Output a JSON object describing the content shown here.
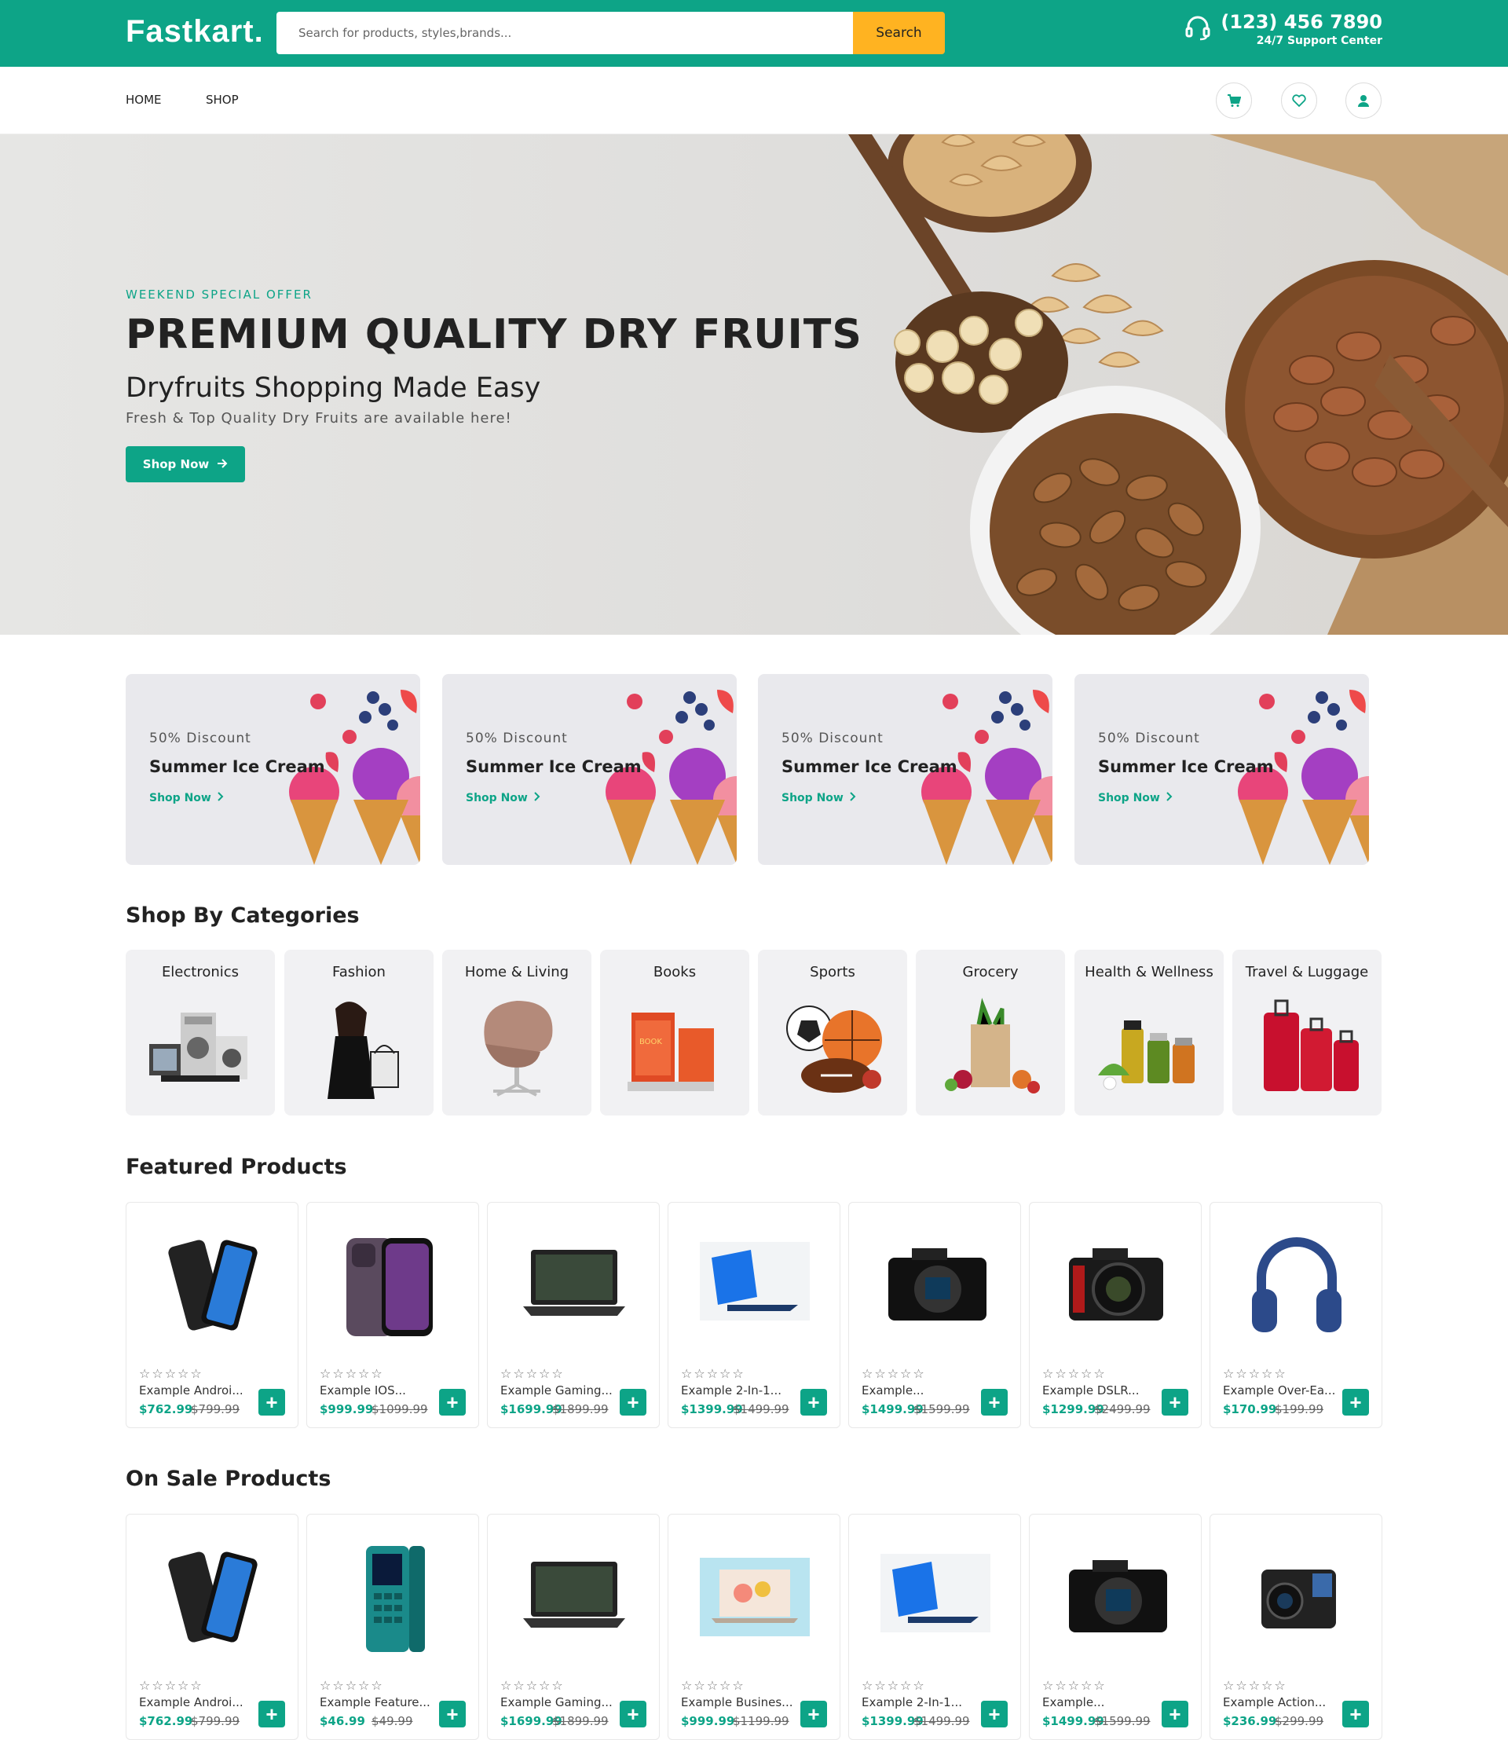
{
  "header": {
    "logo": "Fastkart.",
    "search_placeholder": "Search for products, styles,brands...",
    "search_button": "Search",
    "support_phone": "(123) 456 7890",
    "support_text": "24/7 Support Center"
  },
  "nav": {
    "home": "HOME",
    "shop": "SHOP"
  },
  "hero": {
    "kicker": "WEEKEND SPECIAL OFFER",
    "title": "PREMIUM QUALITY DRY FRUITS",
    "subtitle": "Dryfruits Shopping Made Easy",
    "description": "Fresh & Top Quality Dry Fruits are available here!",
    "button": "Shop Now"
  },
  "promos": [
    {
      "discount": "50% Discount",
      "title": "Summer Ice Cream",
      "link": "Shop Now"
    },
    {
      "discount": "50% Discount",
      "title": "Summer Ice Cream",
      "link": "Shop Now"
    },
    {
      "discount": "50% Discount",
      "title": "Summer Ice Cream",
      "link": "Shop Now"
    },
    {
      "discount": "50% Discount",
      "title": "Summer Ice Cream",
      "link": "Shop Now"
    }
  ],
  "categories_title": "Shop By Categories",
  "categories": [
    {
      "label": "Electronics",
      "icon": "electronics-icon"
    },
    {
      "label": "Fashion",
      "icon": "fashion-icon"
    },
    {
      "label": "Home & Living",
      "icon": "chair-icon"
    },
    {
      "label": "Books",
      "icon": "books-icon"
    },
    {
      "label": "Sports",
      "icon": "sports-balls-icon"
    },
    {
      "label": "Grocery",
      "icon": "grocery-bag-icon"
    },
    {
      "label": "Health & Wellness",
      "icon": "supplements-icon"
    },
    {
      "label": "Travel & Luggage",
      "icon": "luggage-icon"
    }
  ],
  "featured_title": "Featured Products",
  "featured": [
    {
      "name": "Example Androi...",
      "price": "$762.99",
      "old": "$799.99",
      "icon": "phone-icon"
    },
    {
      "name": "Example IOS...",
      "price": "$999.99",
      "old": "$1099.99",
      "icon": "iphone-icon"
    },
    {
      "name": "Example Gaming...",
      "price": "$1699.99",
      "old": "$1899.99",
      "icon": "laptop-icon"
    },
    {
      "name": "Example 2-In-1...",
      "price": "$1399.99",
      "old": "$1499.99",
      "icon": "tablet-icon"
    },
    {
      "name": "Example...",
      "price": "$1499.99",
      "old": "$1599.99",
      "icon": "camera-icon"
    },
    {
      "name": "Example DSLR...",
      "price": "$1299.99",
      "old": "$2499.99",
      "icon": "dslr-icon"
    },
    {
      "name": "Example Over-Ea...",
      "price": "$170.99",
      "old": "$199.99",
      "icon": "headphones-icon"
    }
  ],
  "onsale_title": "On Sale Products",
  "onsale": [
    {
      "name": "Example Androi...",
      "price": "$762.99",
      "old": "$799.99",
      "icon": "phone-icon"
    },
    {
      "name": "Example Feature...",
      "price": "$46.99",
      "old": "$49.99",
      "icon": "feature-phone-icon"
    },
    {
      "name": "Example Gaming...",
      "price": "$1699.99",
      "old": "$1899.99",
      "icon": "laptop-icon"
    },
    {
      "name": "Example Busines...",
      "price": "$999.99",
      "old": "$1199.99",
      "icon": "business-laptop-icon"
    },
    {
      "name": "Example 2-In-1...",
      "price": "$1399.99",
      "old": "$1499.99",
      "icon": "tablet-icon"
    },
    {
      "name": "Example...",
      "price": "$1499.99",
      "old": "$1599.99",
      "icon": "camera-icon"
    },
    {
      "name": "Example Action...",
      "price": "$236.99",
      "old": "$299.99",
      "icon": "action-camera-icon"
    }
  ],
  "stars": "☆☆☆☆☆",
  "add_symbol": "+",
  "colors": {
    "brand": "#0da487",
    "search_button": "#ffb321"
  }
}
